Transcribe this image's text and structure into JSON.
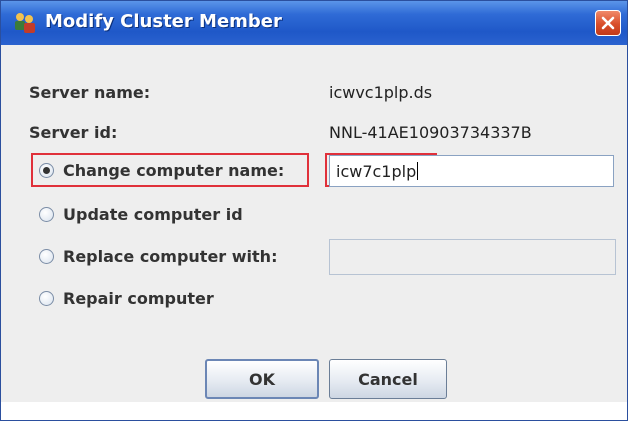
{
  "window": {
    "title": "Modify Cluster Member",
    "title_icon": "cluster-app-icon",
    "close_icon": "close-icon"
  },
  "fields": {
    "server_name_label": "Server name:",
    "server_name_value": "icwvc1plp.ds",
    "server_id_label": "Server id:",
    "server_id_value": "NNL-41AE10903734337B"
  },
  "options": [
    {
      "label": "Change computer name:",
      "checked": true
    },
    {
      "label": "Update computer id",
      "checked": false
    },
    {
      "label": "Replace computer with:",
      "checked": false
    },
    {
      "label": "Repair computer",
      "checked": false
    }
  ],
  "inputs": {
    "change_name_value": "icw7c1plp",
    "replace_with_value": ""
  },
  "buttons": {
    "ok": "OK",
    "cancel": "Cancel"
  },
  "colors": {
    "titlebar": "#2f6bd6",
    "highlight": "#e0303a",
    "panel": "#eeeeee"
  }
}
